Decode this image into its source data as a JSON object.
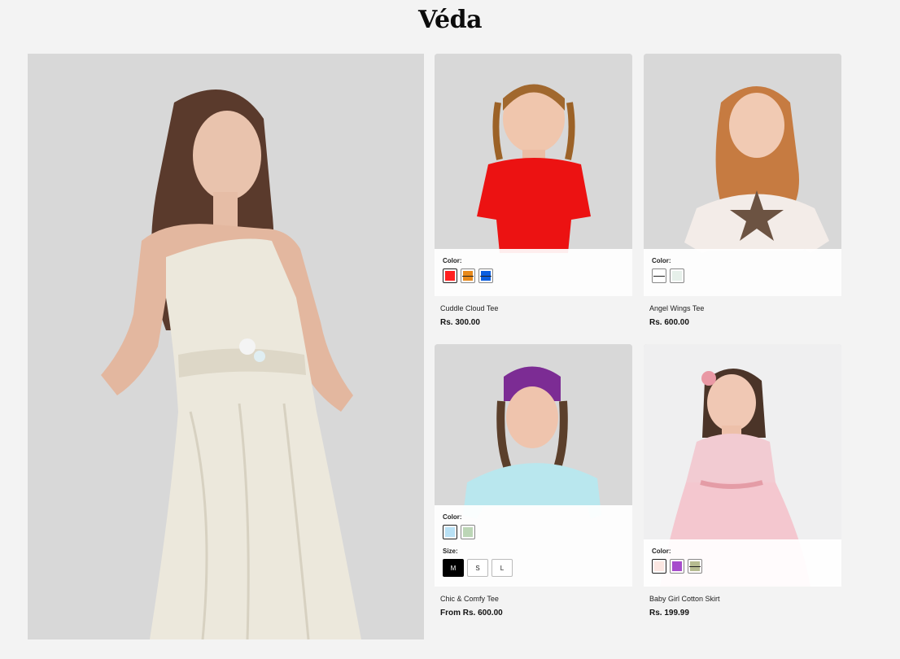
{
  "brand": {
    "name": "Véda"
  },
  "hero": {
    "alt": "woman-in-cream-dress"
  },
  "products": [
    {
      "title": "Cuddle Cloud Tee",
      "price": "Rs. 300.00",
      "color_label": "Color:",
      "colors": [
        "#ff1f1f",
        "#e8891a",
        "#0a5ee0"
      ],
      "size_label": "",
      "sizes": []
    },
    {
      "title": "Angel Wings Tee",
      "price": "Rs. 600.00",
      "color_label": "Color:",
      "colors": [
        "#ffffff",
        "#e6f0ea"
      ],
      "size_label": "",
      "sizes": []
    },
    {
      "title": "Chic & Comfy Tee",
      "price": "From Rs. 600.00",
      "color_label": "Color:",
      "colors": [
        "#b9e1f5",
        "#bcd6b6"
      ],
      "size_label": "Size:",
      "sizes": [
        "M",
        "S",
        "L"
      ]
    },
    {
      "title": "Baby Girl Cotton Skirt",
      "price": "Rs. 199.99",
      "color_label": "Color:",
      "colors": [
        "#fbe6e1",
        "#a64ccc",
        "#b6bb90"
      ],
      "size_label": "",
      "sizes": []
    }
  ]
}
